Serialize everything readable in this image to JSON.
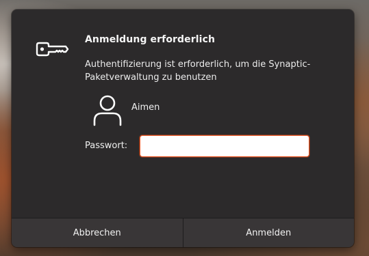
{
  "dialog": {
    "title": "Anmeldung erforderlich",
    "message": "Authentifizierung ist erforderlich, um die Synaptic-Paketverwaltung zu benutzen",
    "icon": "key-icon",
    "user": {
      "avatar_icon": "user-icon",
      "name": "Aimen"
    },
    "password": {
      "label": "Passwort:",
      "value": "",
      "placeholder": ""
    },
    "buttons": {
      "cancel_label": "Abbrechen",
      "confirm_label": "Anmelden"
    }
  },
  "colors": {
    "dialog_bg": "#2c2a2b",
    "button_bg": "#393637",
    "focus_accent": "#e95420"
  }
}
